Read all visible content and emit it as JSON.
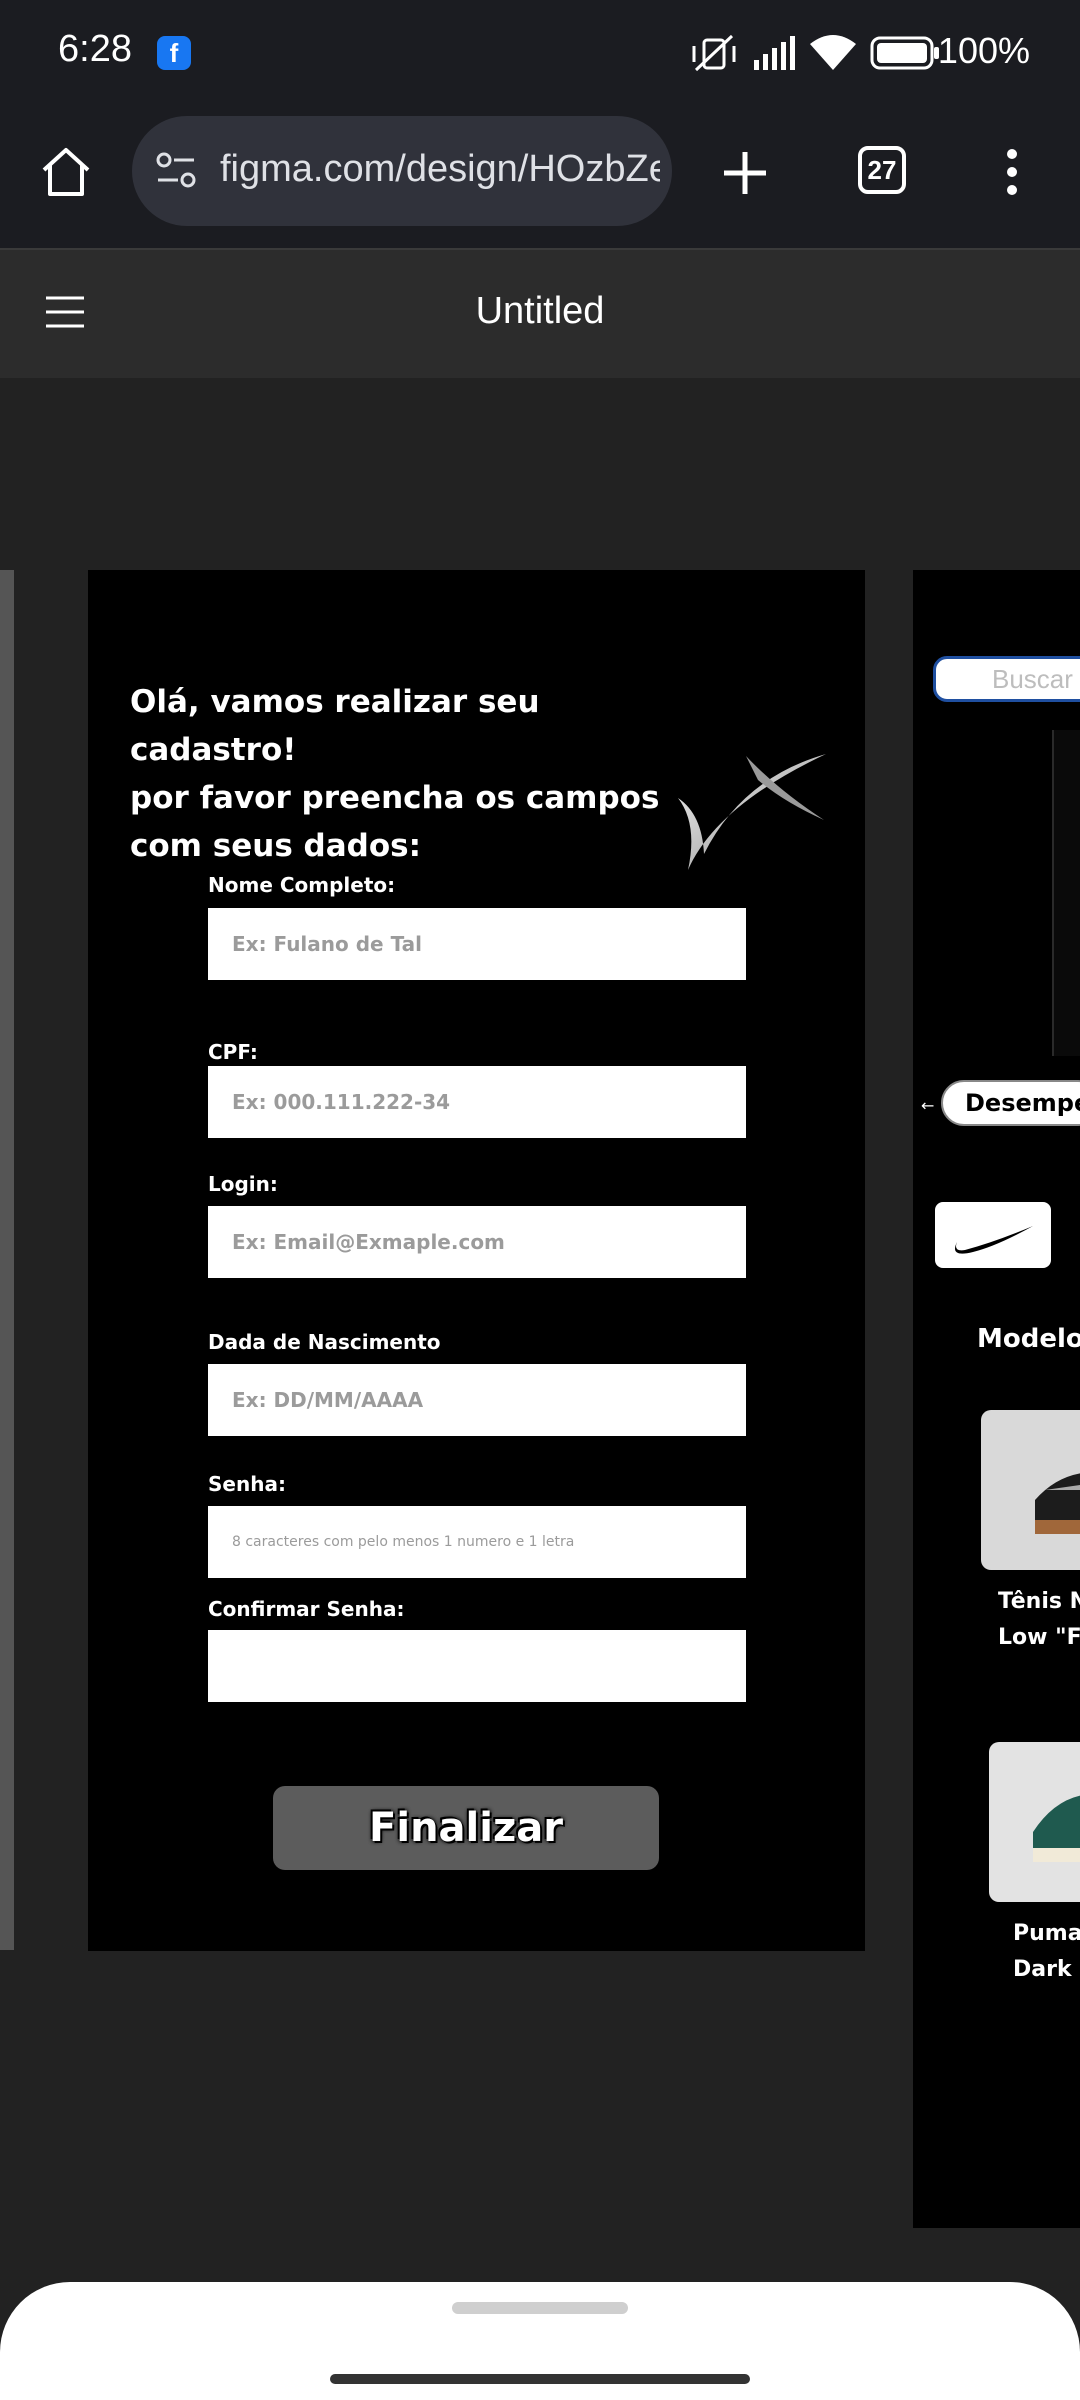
{
  "status_bar": {
    "time": "6:28",
    "battery": "100%"
  },
  "browser": {
    "url": "figma.com/design/HOzbZe",
    "tab_count": "27"
  },
  "figma": {
    "file_title": "Untitled"
  },
  "form": {
    "heading_lines": [
      "Olá, vamos realizar seu cadastro!",
      "por favor preencha os campos",
      "com seus dados:"
    ],
    "fields": [
      {
        "label": "Nome Completo:",
        "placeholder": "Ex: Fulano de Tal"
      },
      {
        "label": "CPF:",
        "placeholder": "Ex: 000.111.222-34"
      },
      {
        "label": "Login:",
        "placeholder": "Ex: Email@Exmaple.com"
      },
      {
        "label": "Dada de Nascimento",
        "placeholder": "Ex: DD/MM/AAAA"
      },
      {
        "label": "Senha:",
        "placeholder": "8 caracteres com pelo menos 1 numero e 1 letra"
      },
      {
        "label": "Confirmar Senha:",
        "placeholder": ""
      }
    ],
    "submit_label": "Finalizar"
  },
  "right_frame": {
    "search_placeholder": "Buscar",
    "chip_label": "Desempe",
    "back_arrow": "←",
    "section_title": "Modelos",
    "products": [
      {
        "name_line1": "Tênis N",
        "name_line2": "Low \"F"
      },
      {
        "name_line1": "Puma",
        "name_line2": "Dark"
      }
    ]
  }
}
